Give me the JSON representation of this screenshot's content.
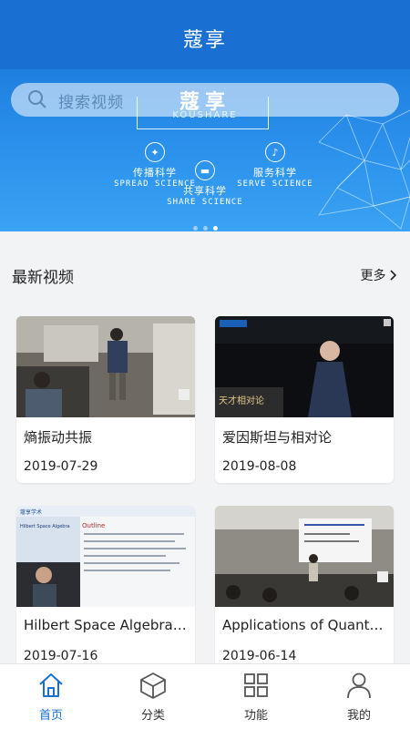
{
  "app": {
    "title": "蔻享"
  },
  "banner": {
    "search_placeholder": "搜索视频",
    "logo_cn": "蔻享",
    "logo_en": "KOUSHARE",
    "features": [
      {
        "icon": "star-icon",
        "cn": "传播科学",
        "en": "SPREAD SCIENCE"
      },
      {
        "icon": "chat-icon",
        "cn": "共享科学",
        "en": "SHARE SCIENCE"
      },
      {
        "icon": "flask-icon",
        "cn": "服务科学",
        "en": "SERVE SCIENCE"
      }
    ],
    "active_slide": 3,
    "slide_count": 3
  },
  "section": {
    "title": "最新视频",
    "more": "更多"
  },
  "videos": [
    {
      "title": "熵振动共振",
      "date": "2019-07-29"
    },
    {
      "title": "爱因斯坦与相对论",
      "date": "2019-08-08"
    },
    {
      "title": "Hilbert Space Algebra and Topological Properties of Fractional Quantum Hall Effect",
      "date": "2019-07-16"
    },
    {
      "title": "Applications of Quantum Entanglement",
      "date": "2019-06-14"
    }
  ],
  "thumb_text": {
    "brand": "蔻享学术",
    "stage": "天才相对论",
    "paper_title": "Hilbert Space Algebra and Topological Properties of Fractional Quantum Hall Effect",
    "outline": "Outline"
  },
  "tabs": [
    {
      "label": "首页",
      "icon": "home-icon",
      "active": true
    },
    {
      "label": "分类",
      "icon": "box-icon",
      "active": false
    },
    {
      "label": "功能",
      "icon": "grid-icon",
      "active": false
    },
    {
      "label": "我的",
      "icon": "user-icon",
      "active": false
    }
  ],
  "colors": {
    "primary": "#1a6fd3",
    "background": "#f2f3f5"
  }
}
